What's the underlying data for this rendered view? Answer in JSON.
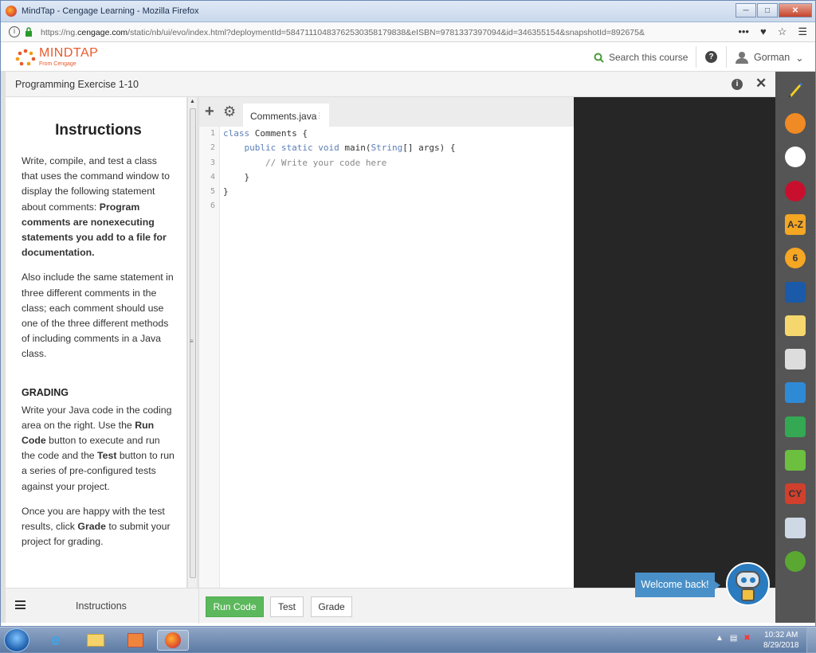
{
  "browser": {
    "window_title": "MindTap - Cengage Learning - Mozilla Firefox",
    "url_prefix": "https://ng.",
    "url_domain": "cengage.com",
    "url_suffix": "/static/nb/ui/evo/index.html?deploymentId=58471110483762530358179838&eISBN=9781337397094&id=346355154&snapshotId=892675&",
    "more_label": "•••"
  },
  "app": {
    "brand": "MINDTAP",
    "brand_sub": "From Cengage",
    "search_label": "Search this course",
    "user_name": "Gorman"
  },
  "activity": {
    "title": "Programming Exercise 1-10"
  },
  "instructions": {
    "heading": "Instructions",
    "p1_text": "Write, compile, and test a class that uses the command window to display the following statement about comments: ",
    "p1_bold": "Program comments are nonexecuting statements you add to a file for documentation.",
    "p2": "Also include the same statement in three different comments in the class; each comment should use one of the three different methods of including comments in a Java class.",
    "grading_heading": "GRADING",
    "g1_a": "Write your Java code in the coding area on the right. Use the ",
    "g1_run": "Run Code",
    "g1_b": " button to execute and run the code and the ",
    "g1_test": "Test",
    "g1_c": " button to run a series of pre-configured tests against your project.",
    "g2_a": "Once you are happy with the test results, click ",
    "g2_grade": "Grade",
    "g2_b": " to submit your project for grading."
  },
  "editor": {
    "tab_name": "Comments.java",
    "line_numbers": [
      "1",
      "2",
      "3",
      "4",
      "5",
      "6"
    ],
    "line1_kw": "class",
    "line1_rest": " Comments {",
    "line2_indent": "    ",
    "line2_kw": "public static void",
    "line2_mid": " main(",
    "line2_type": "String",
    "line2_end": "[] args) {",
    "line3_indent": "        ",
    "line3_comment": "// Write your code here",
    "line4": "    }",
    "line5": "}"
  },
  "bottom": {
    "menu_label": "Instructions",
    "run_label": "Run Code",
    "test_label": "Test",
    "grade_label": "Grade"
  },
  "assistant": {
    "welcome": "Welcome back!"
  },
  "rail": {
    "items": [
      {
        "icon": "rss-icon",
        "color": "#f08a24"
      },
      {
        "icon": "wheel-icon",
        "color": "#ffffff"
      },
      {
        "icon": "merriam-webster-icon",
        "color": "#c8102e"
      },
      {
        "icon": "a-z-icon",
        "color": "#f5a623",
        "text": "A-Z"
      },
      {
        "icon": "flash-6-icon",
        "color": "#f5a623",
        "text": "6"
      },
      {
        "icon": "book-icon",
        "color": "#1a5aa8"
      },
      {
        "icon": "notes-icon",
        "color": "#f5d76e"
      },
      {
        "icon": "readspeaker-icon",
        "color": "#dddddd"
      },
      {
        "icon": "onedrive-icon",
        "color": "#2f8ad6"
      },
      {
        "icon": "google-drive-icon",
        "color": "#34a853"
      },
      {
        "icon": "cart-icon",
        "color": "#6cbf3f"
      },
      {
        "icon": "cy-icon",
        "color": "#d0402c",
        "text": "CY"
      },
      {
        "icon": "flashcards-icon",
        "color": "#cfd9e6"
      },
      {
        "icon": "green-circle-icon",
        "color": "#5aa832"
      }
    ]
  },
  "taskbar": {
    "time": "10:32 AM",
    "date": "8/29/2018"
  }
}
